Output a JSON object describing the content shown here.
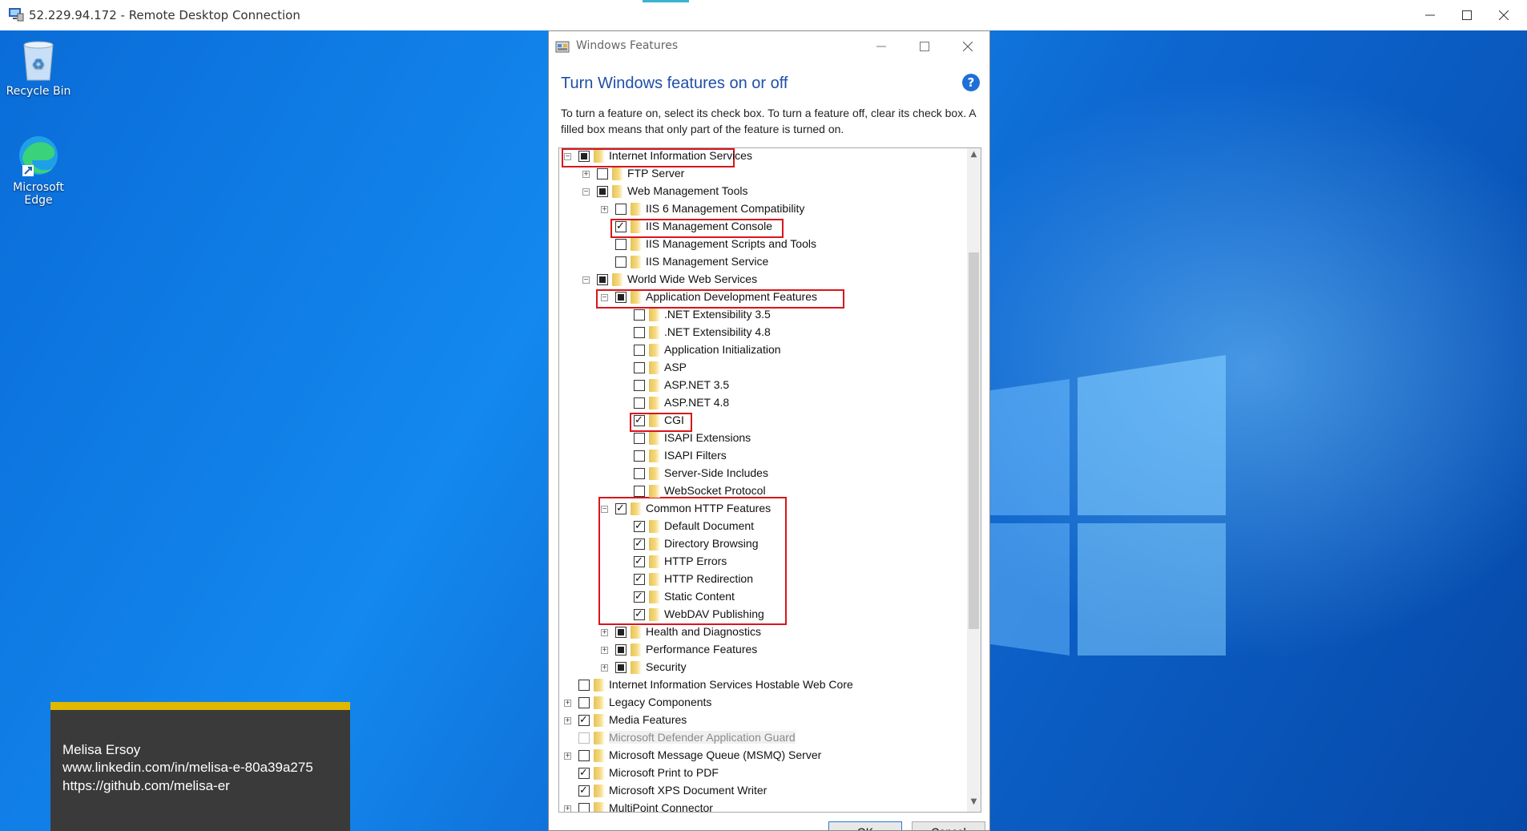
{
  "window": {
    "title": "52.229.94.172 - Remote Desktop Connection"
  },
  "desktop": {
    "icons": [
      {
        "label": "Recycle Bin"
      },
      {
        "label": "Microsoft Edge"
      }
    ]
  },
  "overlay": {
    "name": "Melisa Ersoy",
    "linkedin": "www.linkedin.com/in/melisa-e-80a39a275",
    "github": "https://github.com/melisa-er"
  },
  "dialog": {
    "title": "Windows Features",
    "heading": "Turn Windows features on or off",
    "help": "?",
    "description": "To turn a feature on, select its check box. To turn a feature off, clear its check box. A filled box means that only part of the feature is turned on.",
    "features": [
      {
        "label": "Internet Information Services",
        "level": 0,
        "expander": "minus",
        "state": "partial"
      },
      {
        "label": "FTP Server",
        "level": 1,
        "expander": "plus",
        "state": "unchecked"
      },
      {
        "label": "Web Management Tools",
        "level": 1,
        "expander": "minus",
        "state": "partial"
      },
      {
        "label": "IIS 6 Management Compatibility",
        "level": 2,
        "expander": "plus",
        "state": "unchecked"
      },
      {
        "label": "IIS Management Console",
        "level": 2,
        "expander": "none",
        "state": "checked"
      },
      {
        "label": "IIS Management Scripts and Tools",
        "level": 2,
        "expander": "none",
        "state": "unchecked"
      },
      {
        "label": "IIS Management Service",
        "level": 2,
        "expander": "none",
        "state": "unchecked"
      },
      {
        "label": "World Wide Web Services",
        "level": 1,
        "expander": "minus",
        "state": "partial"
      },
      {
        "label": "Application Development Features",
        "level": 2,
        "expander": "minus",
        "state": "partial"
      },
      {
        "label": ".NET Extensibility 3.5",
        "level": 3,
        "expander": "none",
        "state": "unchecked"
      },
      {
        "label": ".NET Extensibility 4.8",
        "level": 3,
        "expander": "none",
        "state": "unchecked"
      },
      {
        "label": "Application Initialization",
        "level": 3,
        "expander": "none",
        "state": "unchecked"
      },
      {
        "label": "ASP",
        "level": 3,
        "expander": "none",
        "state": "unchecked"
      },
      {
        "label": "ASP.NET 3.5",
        "level": 3,
        "expander": "none",
        "state": "unchecked"
      },
      {
        "label": "ASP.NET 4.8",
        "level": 3,
        "expander": "none",
        "state": "unchecked"
      },
      {
        "label": "CGI",
        "level": 3,
        "expander": "none",
        "state": "checked"
      },
      {
        "label": "ISAPI Extensions",
        "level": 3,
        "expander": "none",
        "state": "unchecked"
      },
      {
        "label": "ISAPI Filters",
        "level": 3,
        "expander": "none",
        "state": "unchecked"
      },
      {
        "label": "Server-Side Includes",
        "level": 3,
        "expander": "none",
        "state": "unchecked"
      },
      {
        "label": "WebSocket Protocol",
        "level": 3,
        "expander": "none",
        "state": "unchecked"
      },
      {
        "label": "Common HTTP Features",
        "level": 2,
        "expander": "minus",
        "state": "checked"
      },
      {
        "label": "Default Document",
        "level": 3,
        "expander": "none",
        "state": "checked"
      },
      {
        "label": "Directory Browsing",
        "level": 3,
        "expander": "none",
        "state": "checked"
      },
      {
        "label": "HTTP Errors",
        "level": 3,
        "expander": "none",
        "state": "checked"
      },
      {
        "label": "HTTP Redirection",
        "level": 3,
        "expander": "none",
        "state": "checked"
      },
      {
        "label": "Static Content",
        "level": 3,
        "expander": "none",
        "state": "checked"
      },
      {
        "label": "WebDAV Publishing",
        "level": 3,
        "expander": "none",
        "state": "checked"
      },
      {
        "label": "Health and Diagnostics",
        "level": 2,
        "expander": "plus",
        "state": "partial"
      },
      {
        "label": "Performance Features",
        "level": 2,
        "expander": "plus",
        "state": "partial"
      },
      {
        "label": "Security",
        "level": 2,
        "expander": "plus",
        "state": "partial"
      },
      {
        "label": "Internet Information Services Hostable Web Core",
        "level": 0,
        "expander": "none",
        "state": "unchecked"
      },
      {
        "label": "Legacy Components",
        "level": 0,
        "expander": "plus",
        "state": "unchecked"
      },
      {
        "label": "Media Features",
        "level": 0,
        "expander": "plus",
        "state": "checked"
      },
      {
        "label": "Microsoft Defender Application Guard",
        "level": 0,
        "expander": "none",
        "state": "disabled"
      },
      {
        "label": "Microsoft Message Queue (MSMQ) Server",
        "level": 0,
        "expander": "plus",
        "state": "unchecked"
      },
      {
        "label": "Microsoft Print to PDF",
        "level": 0,
        "expander": "none",
        "state": "checked"
      },
      {
        "label": "Microsoft XPS Document Writer",
        "level": 0,
        "expander": "none",
        "state": "checked"
      },
      {
        "label": "MultiPoint Connector",
        "level": 0,
        "expander": "plus",
        "state": "unchecked"
      }
    ],
    "ok_label": "OK",
    "cancel_label": "Cancel"
  },
  "colors": {
    "highlight_box": "#d9151c",
    "heading": "#1f4fa8",
    "overlay_accent": "#e0b800"
  }
}
